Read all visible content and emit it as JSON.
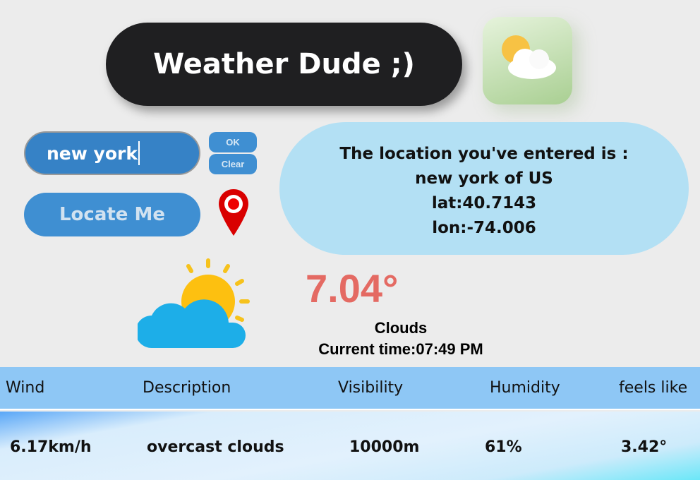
{
  "header": {
    "title": "Weather Dude ;)",
    "app_icon": "sun-cloud-icon"
  },
  "search": {
    "value": "new york",
    "ok_label": "OK",
    "clear_label": "Clear"
  },
  "locate": {
    "label": "Locate Me",
    "icon": "map-pin-icon"
  },
  "location": {
    "line1": "The location you've entered is :",
    "line2": "new york of US",
    "lat": "lat:40.7143",
    "lon": "lon:-74.006"
  },
  "current": {
    "temperature": "7.04°",
    "condition": "Clouds",
    "time": "Current time:07:49 PM",
    "icon": "partly-cloudy-icon"
  },
  "details": {
    "headers": [
      "Wind",
      "Description",
      "Visibility",
      "Humidity",
      "feels like"
    ],
    "values": [
      "6.17km/h",
      "overcast clouds",
      "10000m",
      "61%",
      "3.42°"
    ]
  },
  "colors": {
    "accent": "#3682c6",
    "temp": "#e46a63",
    "info_bg": "#b3e0f4"
  }
}
